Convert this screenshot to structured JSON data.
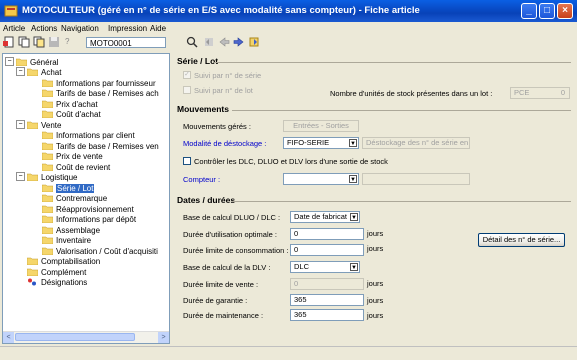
{
  "window": {
    "title": "MOTOCULTEUR (géré en n° de série en E/S avec modalité sans compteur) - Fiche article"
  },
  "menu": [
    "Article",
    "Actions",
    "Navigation",
    "Impression",
    "Aide"
  ],
  "toolbar": {
    "code": "MOTO0001"
  },
  "tree": {
    "general": "Général",
    "achat": "Achat",
    "achat_items": [
      "Informations par fournisseur",
      "Tarifs de base / Remises ach",
      "Prix d'achat",
      "Coût d'achat"
    ],
    "vente": "Vente",
    "vente_items": [
      "Informations par client",
      "Tarifs de base / Remises ven",
      "Prix de vente",
      "Coût de revient"
    ],
    "logistique": "Logistique",
    "logistique_items": [
      "Série / Lot",
      "Contremarque",
      "Réapprovisionnement",
      "Informations par dépôt",
      "Assemblage",
      "Inventaire",
      "Valorisation / Coût d'acquisiti"
    ],
    "comptabilisation": "Comptabilisation",
    "complement": "Complément",
    "designations": "Désignations"
  },
  "serie_lot": {
    "title": "Série / Lot",
    "suivi_serie": "Suivi par n° de série",
    "suivi_lot": "Suivi par n° de lot",
    "nb_unites_label": "Nombre d'unités de stock présentes dans un lot :",
    "nb_unites_unit": "PCE",
    "nb_unites_value": "0"
  },
  "mouvements": {
    "title": "Mouvements",
    "geres_label": "Mouvements gérés :",
    "geres_value": "Entrées - Sorties",
    "modalite_label": "Modalité de déstockage :",
    "modalite_value": "FIFO-SERIE",
    "modalite_desc": "Déstockage des n° de série en FIFO",
    "controle_label": "Contrôler les DLC, DLUO et DLV lors d'une sortie de stock",
    "compteur_label": "Compteur :",
    "compteur_value": ""
  },
  "dates": {
    "title": "Dates / durées",
    "base_dluo_label": "Base de calcul DLUO / DLC :",
    "base_dluo_value": "Date de fabricat",
    "duree_opt_label": "Durée d'utilisation optimale :",
    "duree_opt_value": "0",
    "duree_conso_label": "Durée limite de consommation :",
    "duree_conso_value": "0",
    "base_dlv_label": "Base de calcul de la DLV :",
    "base_dlv_value": "DLC",
    "duree_vente_label": "Durée limite de vente :",
    "duree_vente_value": "0",
    "garantie_label": "Durée de garantie :",
    "garantie_value": "365",
    "maintenance_label": "Durée de maintenance :",
    "maintenance_value": "365",
    "jours": "jours",
    "detail_button": "Détail des n° de série..."
  },
  "colors": {
    "selection": "#316ac5",
    "titlebar": "#0842b8",
    "link": "#0000cc"
  }
}
